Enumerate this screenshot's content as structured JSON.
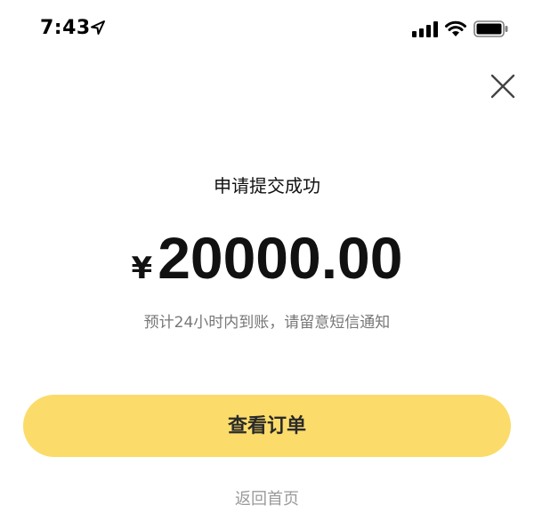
{
  "status_bar": {
    "time": "7:43",
    "icons": [
      "location-arrow-icon",
      "cellular-signal-icon",
      "wifi-icon",
      "battery-icon"
    ]
  },
  "header": {
    "close_icon": "close-icon"
  },
  "main": {
    "title": "申请提交成功",
    "currency_symbol": "¥",
    "amount": "20000.00",
    "notice": "预计24小时内到账，请留意短信通知"
  },
  "actions": {
    "view_order_label": "查看订单",
    "back_home_label": "返回首页"
  },
  "colors": {
    "primary_button": "#fbdc6a",
    "secondary_text": "#777777",
    "link_text": "#9a9a9a"
  }
}
